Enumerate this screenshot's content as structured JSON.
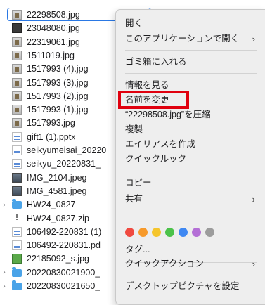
{
  "files": [
    {
      "name": "22298508.jpg",
      "icon": "image-file-icon",
      "selected": true
    },
    {
      "name": "23048080.jpg",
      "icon": "image-file-icon"
    },
    {
      "name": "22319061.jpg",
      "icon": "image-file-icon"
    },
    {
      "name": "1511019.jpg",
      "icon": "image-file-icon"
    },
    {
      "name": "1517993 (4).jpg",
      "icon": "image-file-icon"
    },
    {
      "name": "1517993 (3).jpg",
      "icon": "image-file-icon"
    },
    {
      "name": "1517993 (2).jpg",
      "icon": "image-file-icon"
    },
    {
      "name": "1517993 (1).jpg",
      "icon": "image-file-icon"
    },
    {
      "name": "1517993.jpg",
      "icon": "image-file-icon"
    },
    {
      "name": "gift1 (1).pptx",
      "icon": "document-icon"
    },
    {
      "name": "seikyumeisai_20220",
      "icon": "document-icon"
    },
    {
      "name": "seikyu_20220831_",
      "icon": "document-icon"
    },
    {
      "name": "IMG_2104.jpeg",
      "icon": "photo-file-icon"
    },
    {
      "name": "IMG_4581.jpeg",
      "icon": "photo-file-icon"
    },
    {
      "name": "HW24_0827",
      "icon": "folder-icon",
      "disclosure": "›"
    },
    {
      "name": "HW24_0827.zip",
      "icon": "zip-file-icon"
    },
    {
      "name": "106492-220831 (1)",
      "icon": "document-icon"
    },
    {
      "name": "106492-220831.pd",
      "icon": "document-icon"
    },
    {
      "name": "22185092_s.jpg",
      "icon": "image-file-icon"
    },
    {
      "name": "20220830021900_",
      "icon": "folder-icon",
      "disclosure": "›"
    },
    {
      "name": "20220830021650_",
      "icon": "folder-icon",
      "disclosure": "›"
    }
  ],
  "context_menu": {
    "open": "開く",
    "open_with": "このアプリケーションで開く",
    "move_to_trash": "ゴミ箱に入れる",
    "get_info": "情報を見る",
    "rename": "名前を変更",
    "compress": "“22298508.jpg”を圧縮",
    "duplicate": "複製",
    "make_alias": "エイリアスを作成",
    "quick_look": "クイックルック",
    "copy": "コピー",
    "share": "共有",
    "tags": "タグ...",
    "quick_actions": "クイックアクション",
    "set_desktop_picture": "デスクトップピクチャを設定",
    "submenu_arrow": "›",
    "tag_colors": [
      "#f04a40",
      "#f79a2b",
      "#f5c52c",
      "#4cc24a",
      "#3f88f2",
      "#b46fd6",
      "#9c9c9c"
    ]
  }
}
